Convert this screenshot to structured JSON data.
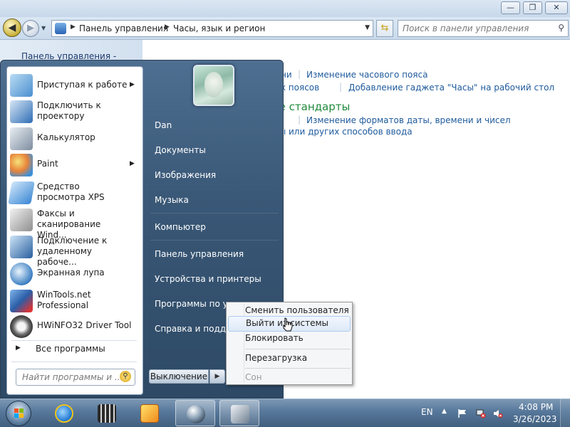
{
  "window": {
    "minimize": "—",
    "maximize": "❐",
    "close": "✕"
  },
  "address": {
    "parts": [
      "Панель управления",
      "Часы, язык и регион"
    ],
    "search_placeholder": "Поиск в панели управления"
  },
  "leftnav": {
    "home_link": "Панель управления -"
  },
  "content": {
    "row1": [
      "ни",
      "Изменение часового пояса"
    ],
    "row2": [
      "овых поясов",
      "Добавление гаджета \"Часы\" на рабочий стол"
    ],
    "heading": "ные стандарты",
    "row3": [
      "е",
      "Изменение форматов даты, времени и чисел"
    ],
    "row4": "туры или других способов ввода"
  },
  "startmenu": {
    "programs": [
      {
        "label": "Приступая к работе",
        "has_submenu": true,
        "icon": "getting-started-icon"
      },
      {
        "label": "Подключить к проектору",
        "has_submenu": false,
        "icon": "projector-icon"
      },
      {
        "label": "Калькулятор",
        "has_submenu": false,
        "icon": "calculator-icon"
      },
      {
        "label": "Paint",
        "has_submenu": true,
        "icon": "paint-icon"
      },
      {
        "label": "Средство просмотра XPS",
        "has_submenu": false,
        "icon": "xps-viewer-icon"
      },
      {
        "label": "Факсы и сканирование Wind...",
        "has_submenu": false,
        "icon": "fax-scan-icon"
      },
      {
        "label": "Подключение к удаленному рабоче...",
        "has_submenu": false,
        "icon": "remote-desktop-icon"
      },
      {
        "label": "Экранная лупа",
        "has_submenu": false,
        "icon": "magnifier-icon"
      },
      {
        "label": "WinTools.net Professional",
        "has_submenu": false,
        "icon": "wintools-icon"
      },
      {
        "label": "HWiNFO32 Driver Tool",
        "has_submenu": false,
        "icon": "hwinfo-icon"
      }
    ],
    "all_programs": "Все программы",
    "search_placeholder": "Найти программы и ...",
    "right_items": [
      "Dan",
      "Документы",
      "Изображения",
      "Музыка",
      "Компьютер",
      "Панель управления",
      "Устройства и принтеры",
      "Программы по ум",
      "Справка и поддерж"
    ],
    "shutdown_label": "Выключение",
    "shutdown_arrow": "▶"
  },
  "context_menu": {
    "items": [
      {
        "label": "Сменить пользователя",
        "state": "normal"
      },
      {
        "label": "Выйти из системы",
        "state": "hover"
      },
      {
        "label": "Блокировать",
        "state": "normal"
      },
      {
        "label": "Перезагрузка",
        "state": "normal"
      },
      {
        "label": "Сон",
        "state": "disabled"
      }
    ]
  },
  "taskbar": {
    "language": "EN",
    "time": "4:08 PM",
    "date": "3/26/2023",
    "pinned": [
      "internet-explorer-icon",
      "film-clapper-icon",
      "media-player-icon",
      "sphere-app-icon",
      "hwinfo-taskbar-icon"
    ]
  }
}
